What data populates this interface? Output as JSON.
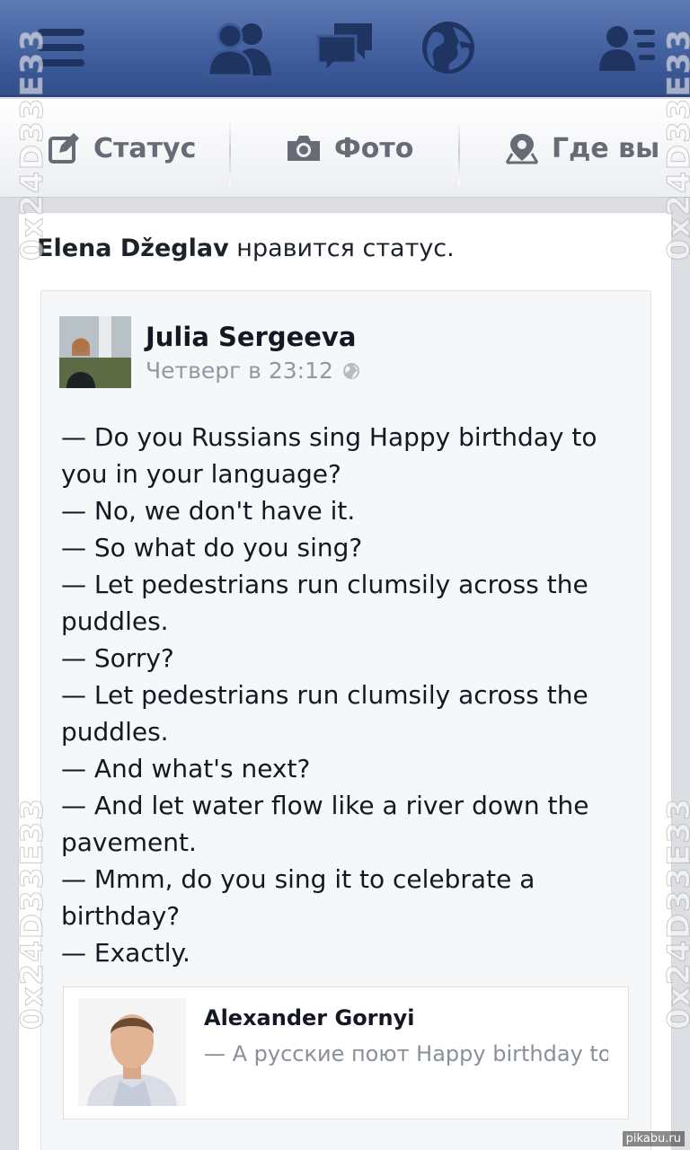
{
  "topbar": {
    "icons": [
      "menu-icon",
      "friends-icon",
      "messages-icon",
      "globe-icon",
      "friends-list-icon"
    ],
    "color_bg": "#3b5998"
  },
  "publisher": {
    "status_label": "Статус",
    "photo_label": "Фото",
    "place_label": "Где вы"
  },
  "story": {
    "actor": "Elena Džeglav",
    "action": " нравится статус."
  },
  "post": {
    "author": "Julia Sergeeva",
    "timestamp": "Четверг в 23:12",
    "lines": [
      "— Do you Russians sing Happy birthday to",
      "you in your language?",
      "— No, we don't have it.",
      "— So what do you sing?",
      "— Let pedestrians run clumsily across the",
      "puddles.",
      "— Sorry?",
      "— Let pedestrians run clumsily across the",
      "puddles.",
      "— And what's next?",
      "— And let water flow like a river down the",
      "pavement.",
      "— Mmm, do you sing it to celebrate a",
      "birthday?",
      "— Exactly."
    ]
  },
  "shared": {
    "author": "Alexander Gornyi",
    "text": "— А русские поют Happy birthday to"
  },
  "watermark": "0x24D33E33",
  "credit": "pikabu.ru"
}
